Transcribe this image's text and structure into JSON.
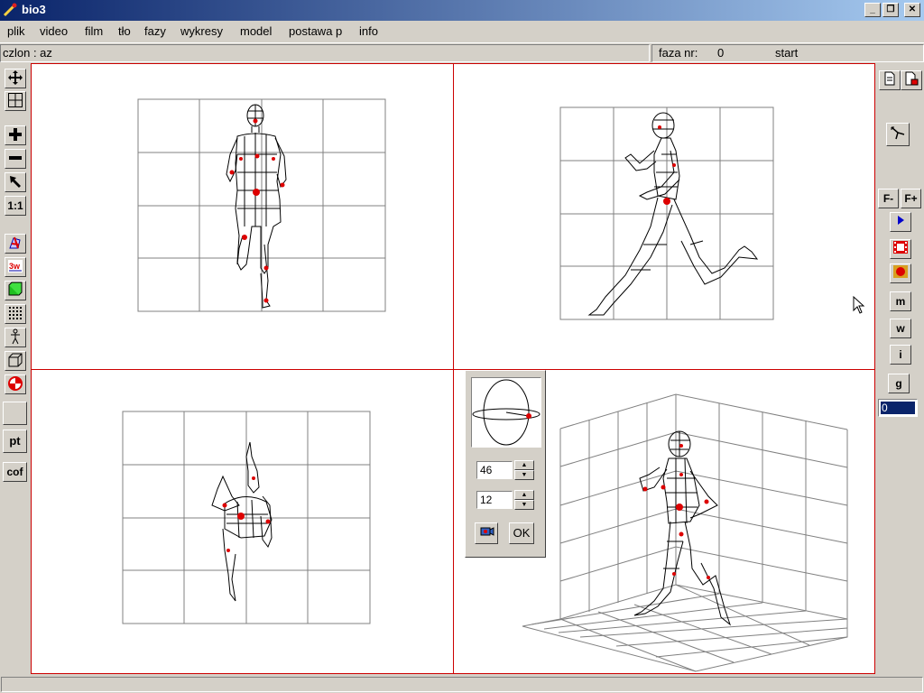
{
  "window": {
    "title": "bio3"
  },
  "menu": [
    "plik",
    "video",
    "film",
    "tło",
    "fazy",
    "wykresy",
    "model",
    "postawa p",
    "info"
  ],
  "status": {
    "segment": "czlon : az",
    "phase_label": "faza nr:",
    "phase_value": "0",
    "mode": "start"
  },
  "left_toolbar": {
    "one_to_one": "1:1",
    "pt": "pt",
    "cof": "cof"
  },
  "right_toolbar": {
    "f_minus": "F-",
    "f_plus": "F+",
    "m": "m",
    "w": "w",
    "i": "i",
    "g": "g",
    "frame_value": "0"
  },
  "view_dialog": {
    "angle1": "46",
    "angle2": "12",
    "ok_label": "OK"
  },
  "colors": {
    "border_red": "#cc0000",
    "marker_red": "#dd0000",
    "grid_gray": "#808080"
  }
}
